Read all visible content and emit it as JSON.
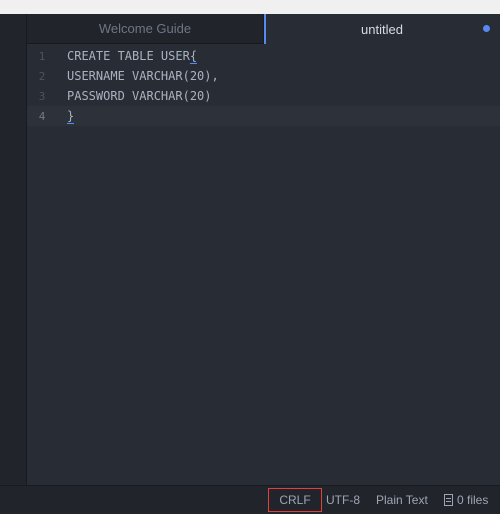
{
  "tabs": [
    {
      "label": "Welcome Guide",
      "active": false
    },
    {
      "label": "untitled",
      "active": true,
      "modified": true
    }
  ],
  "editor": {
    "lines": [
      {
        "number": "1",
        "text_before": "CREATE TABLE USER",
        "bracket": "{"
      },
      {
        "number": "2",
        "text": "USERNAME VARCHAR(20),"
      },
      {
        "number": "3",
        "text": "PASSWORD VARCHAR(20)"
      },
      {
        "number": "4",
        "bracket": "}"
      }
    ]
  },
  "statusbar": {
    "line_ending": "CRLF",
    "encoding": "UTF-8",
    "grammar": "Plain Text",
    "files": "0 files"
  },
  "colors": {
    "accent": "#568af2",
    "highlight_box": "#e0413d"
  },
  "icons": {
    "modified_indicator": "dot",
    "files_icon": "file-icon"
  }
}
